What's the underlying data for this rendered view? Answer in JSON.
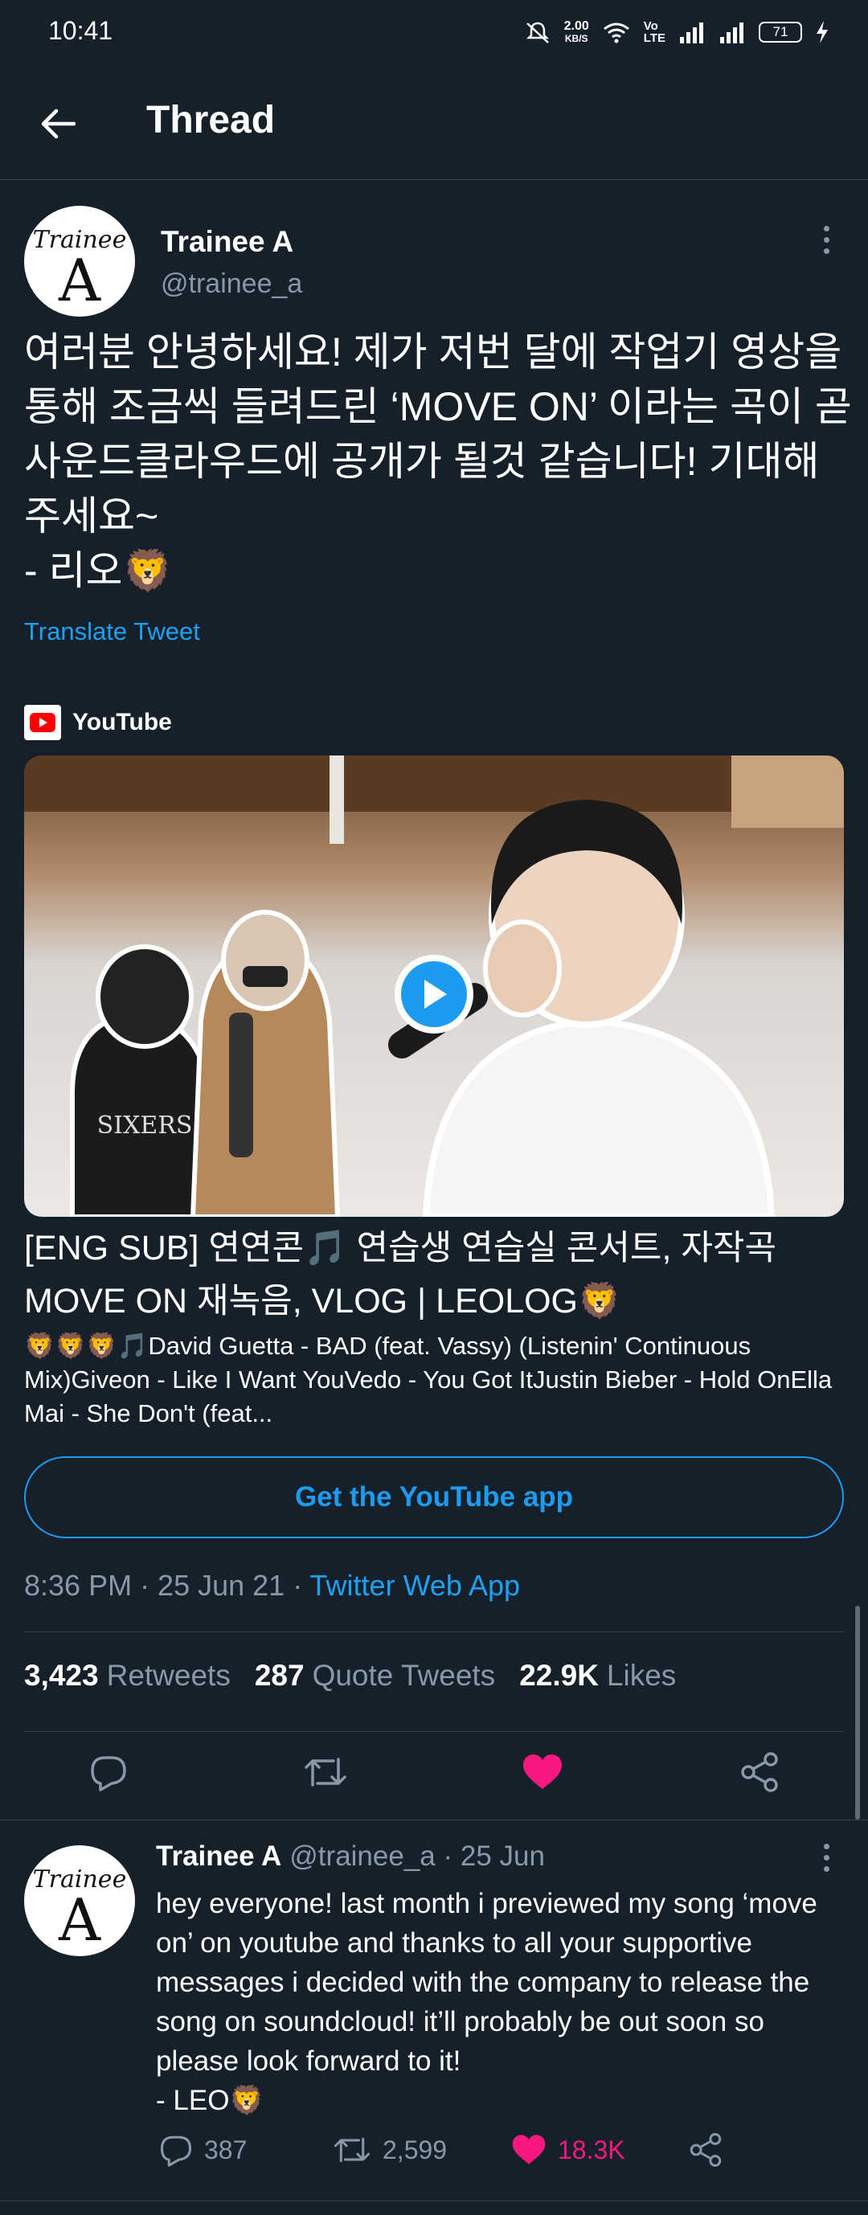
{
  "status_bar": {
    "time": "10:41",
    "speed_value": "2.00",
    "speed_unit": "KB/S",
    "volte_top": "Vo",
    "volte_bottom": "LTE",
    "battery": "71"
  },
  "header": {
    "title": "Thread"
  },
  "main_tweet": {
    "author_name": "Trainee A",
    "author_handle": "@trainee_a",
    "avatar_text_top": "Trainee",
    "avatar_text_bottom": "A",
    "text": "여러분 안녕하세요! 제가 저번 달에 작업기 영상을 통해 조금씩 들려드린 ‘MOVE ON’ 이라는 곡이 곧 사운드클라우드에 공개가 될것 같습니다! 기대해주세요~\n- 리오🦁",
    "translate_label": "Translate Tweet",
    "card": {
      "source": "YouTube",
      "title": "[ENG SUB] 연연콘🎵 연습생 연습실 콘서트, 자작곡 MOVE ON 재녹음, VLOG | LEOLOG🦁",
      "description": "🦁🦁🦁🎵David Guetta - BAD (feat. Vassy) (Listenin' Continuous Mix)Giveon - Like I Want YouVedo - You Got ItJustin Bieber - Hold OnElla Mai - She Don't (feat...",
      "cta": "Get the YouTube app"
    },
    "timestamp": "8:36 PM · 25 Jun 21 · ",
    "client": "Twitter Web App",
    "stats": {
      "retweets_count": "3,423",
      "retweets_label": "Retweets",
      "quotes_count": "287",
      "quotes_label": "Quote Tweets",
      "likes_count": "22.9K",
      "likes_label": "Likes"
    },
    "liked": true
  },
  "reply_tweet": {
    "author_name": "Trainee A",
    "author_handle": "@trainee_a",
    "date": "· 25 Jun",
    "text": "hey everyone! last month i previewed my song ‘move on’ on youtube and thanks to all your supportive messages i decided with the company to release the song on soundcloud! it’ll probably be out soon so please look forward to it!\n- LEO🦁",
    "reply_count": "387",
    "retweet_count": "2,599",
    "like_count": "18.3K"
  },
  "colors": {
    "background": "#15202b",
    "accent": "#1d9bf0",
    "like": "#f91880",
    "muted": "#8899a6",
    "divider": "#38444d"
  },
  "icons": [
    "back-arrow-icon",
    "more-icon",
    "youtube-logo-icon",
    "play-icon",
    "reply-icon",
    "retweet-icon",
    "like-icon",
    "share-icon"
  ]
}
